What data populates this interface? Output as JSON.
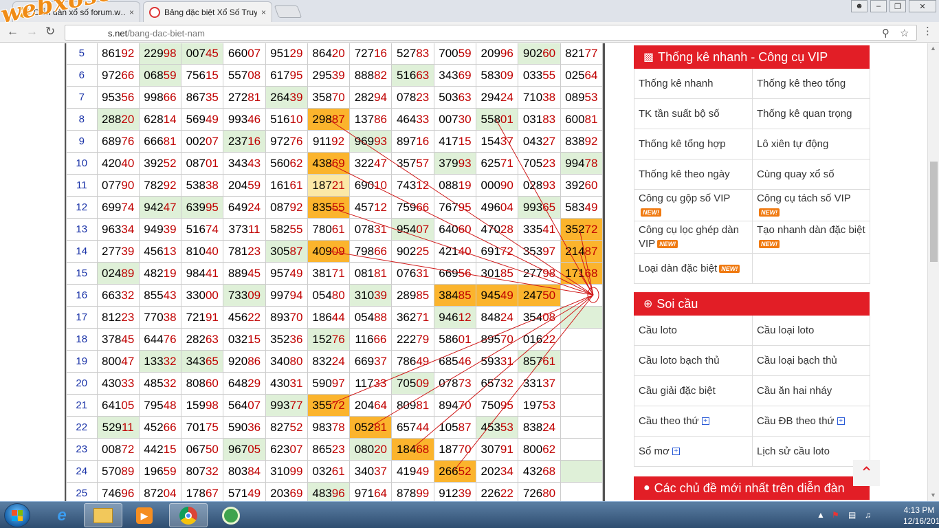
{
  "watermark": "webxoso.net",
  "browser": {
    "tabs": [
      {
        "title": "Diễn đàn xổ số forum.w…",
        "favicon_text": "XS",
        "close": "×"
      },
      {
        "title": "Bảng đặc biệt Xổ Số Truy",
        "favicon_text": "",
        "close": "×"
      }
    ],
    "url_host": "s.net",
    "url_path": "/bang-dac-biet-nam",
    "icons": [
      "back-icon",
      "forward-icon",
      "reload-icon",
      "zoom-icon",
      "star-icon",
      "menu-icon"
    ],
    "window_controls": [
      "user-icon",
      "minimize-icon",
      "restore-icon",
      "close-icon"
    ]
  },
  "table": {
    "rows": [
      {
        "no": "5",
        "cells": [
          "86192",
          "22998",
          "00745",
          "66007",
          "95129",
          "86420",
          "72716",
          "52783",
          "70059",
          "20996",
          "90260",
          "82177"
        ]
      },
      {
        "no": "6",
        "cells": [
          "97266",
          "06859",
          "75615",
          "55708",
          "61795",
          "29539",
          "88882",
          "51663",
          "34369",
          "58309",
          "03355",
          "02564"
        ]
      },
      {
        "no": "7",
        "cells": [
          "95356",
          "99866",
          "86735",
          "27281",
          "26439",
          "35870",
          "28294",
          "07823",
          "50363",
          "29424",
          "71038",
          "08953"
        ]
      },
      {
        "no": "8",
        "cells": [
          "28820",
          "62814",
          "56949",
          "99346",
          "51610",
          "29887",
          "13786",
          "46433",
          "00730",
          "55801",
          "03183",
          "60081"
        ]
      },
      {
        "no": "9",
        "cells": [
          "68976",
          "66681",
          "00207",
          "23716",
          "97276",
          "91192",
          "96993",
          "89716",
          "41715",
          "15437",
          "04327",
          "83892"
        ]
      },
      {
        "no": "10",
        "cells": [
          "42040",
          "39252",
          "08701",
          "34343",
          "56062",
          "43869",
          "32247",
          "35757",
          "37993",
          "62571",
          "70523",
          "99478"
        ]
      },
      {
        "no": "11",
        "cells": [
          "07790",
          "78292",
          "53838",
          "20459",
          "16161",
          "18721",
          "69010",
          "74312",
          "08819",
          "00090",
          "02893",
          "39260"
        ]
      },
      {
        "no": "12",
        "cells": [
          "69974",
          "94247",
          "63995",
          "64924",
          "08792",
          "83555",
          "45712",
          "75966",
          "76795",
          "49604",
          "99365",
          "58349"
        ]
      },
      {
        "no": "13",
        "cells": [
          "96334",
          "94939",
          "51674",
          "37311",
          "58255",
          "78061",
          "07831",
          "95407",
          "64060",
          "47028",
          "33541",
          "35272"
        ]
      },
      {
        "no": "14",
        "cells": [
          "27739",
          "45613",
          "81040",
          "78123",
          "30587",
          "40909",
          "79866",
          "90225",
          "42140",
          "69172",
          "35397",
          "21487"
        ]
      },
      {
        "no": "15",
        "cells": [
          "02489",
          "48219",
          "98441",
          "88945",
          "95749",
          "38171",
          "08181",
          "07631",
          "66956",
          "30185",
          "27798",
          "17168"
        ]
      },
      {
        "no": "16",
        "cells": [
          "66332",
          "85543",
          "33000",
          "73309",
          "99794",
          "05480",
          "31039",
          "28985",
          "38485",
          "94549",
          "24750",
          ""
        ]
      },
      {
        "no": "17",
        "cells": [
          "81223",
          "77038",
          "72191",
          "45622",
          "89370",
          "18644",
          "05488",
          "36271",
          "94612",
          "84824",
          "35408",
          ""
        ]
      },
      {
        "no": "18",
        "cells": [
          "37845",
          "64476",
          "28263",
          "03215",
          "35236",
          "15276",
          "11666",
          "22279",
          "58601",
          "89570",
          "01622",
          ""
        ]
      },
      {
        "no": "19",
        "cells": [
          "80047",
          "13332",
          "34365",
          "92086",
          "34080",
          "83224",
          "66937",
          "78649",
          "68546",
          "59331",
          "85761",
          ""
        ]
      },
      {
        "no": "20",
        "cells": [
          "43033",
          "48532",
          "80860",
          "64829",
          "43031",
          "59097",
          "11733",
          "70509",
          "07873",
          "65732",
          "33137",
          ""
        ]
      },
      {
        "no": "21",
        "cells": [
          "64105",
          "79548",
          "15998",
          "56407",
          "99377",
          "35572",
          "20464",
          "80981",
          "89470",
          "75095",
          "19753",
          ""
        ]
      },
      {
        "no": "22",
        "cells": [
          "52911",
          "45266",
          "70175",
          "59036",
          "82752",
          "98378",
          "05281",
          "65744",
          "10587",
          "45353",
          "83824",
          ""
        ]
      },
      {
        "no": "23",
        "cells": [
          "00872",
          "44215",
          "06750",
          "96705",
          "62307",
          "86523",
          "08020",
          "18468",
          "18770",
          "30791",
          "80062",
          ""
        ]
      },
      {
        "no": "24",
        "cells": [
          "57089",
          "19659",
          "80732",
          "80384",
          "31099",
          "03261",
          "34037",
          "41949",
          "26652",
          "20234",
          "43268",
          ""
        ]
      },
      {
        "no": "25",
        "cells": [
          "74696",
          "87204",
          "17867",
          "57149",
          "20369",
          "48396",
          "97164",
          "87899",
          "91239",
          "22622",
          "72680",
          ""
        ]
      }
    ]
  },
  "sidebar": {
    "thong_ke": {
      "title": "Thống kê nhanh - Công cụ VIP",
      "items": [
        {
          "label": "Thống kê nhanh",
          "new": false
        },
        {
          "label": "Thống kê theo tổng",
          "new": false
        },
        {
          "label": "TK tần suất bộ số",
          "new": false
        },
        {
          "label": "Thống kê quan trọng",
          "new": false
        },
        {
          "label": "Thống kê tổng hợp",
          "new": false
        },
        {
          "label": "Lô xiên tự động",
          "new": false
        },
        {
          "label": "Thống kê theo ngày",
          "new": false
        },
        {
          "label": "Cùng quay xổ số",
          "new": false
        },
        {
          "label": "Công cụ gộp số VIP",
          "new": true
        },
        {
          "label": "Công cụ tách số VIP",
          "new": true
        },
        {
          "label": "Công cụ lọc ghép dàn VIP",
          "new": true
        },
        {
          "label": "Tạo nhanh dàn đặc biệt",
          "new": true
        },
        {
          "label": "Loại dàn đặc biệt",
          "new": true
        },
        {
          "label": "",
          "new": false
        }
      ]
    },
    "soi_cau": {
      "title": "Soi cầu",
      "items": [
        {
          "label": "Cầu loto",
          "plus": false
        },
        {
          "label": "Cầu loại loto",
          "plus": false
        },
        {
          "label": "Cầu loto bạch thủ",
          "plus": false
        },
        {
          "label": "Cầu loại bạch thủ",
          "plus": false
        },
        {
          "label": "Cầu giải đặc biệt",
          "plus": false
        },
        {
          "label": "Cầu ăn hai nháy",
          "plus": false
        },
        {
          "label": "Cầu theo thứ",
          "plus": true
        },
        {
          "label": "Cầu ĐB theo thứ",
          "plus": true
        },
        {
          "label": "Sổ mơ",
          "plus": true
        },
        {
          "label": "Lịch sử cầu loto",
          "plus": false
        }
      ]
    },
    "forum": {
      "title": "Các chủ đề mới nhất trên diễn đàn"
    },
    "new_badge": "NEW!",
    "back_to_top_icon": "chevron-up-icon"
  },
  "taskbar": {
    "time": "4:13 PM",
    "date": "12/16/2017",
    "apps": [
      "explorer-icon",
      "ie-icon",
      "folder-icon",
      "media-player-icon",
      "chrome-icon",
      "coccoc-icon"
    ]
  }
}
